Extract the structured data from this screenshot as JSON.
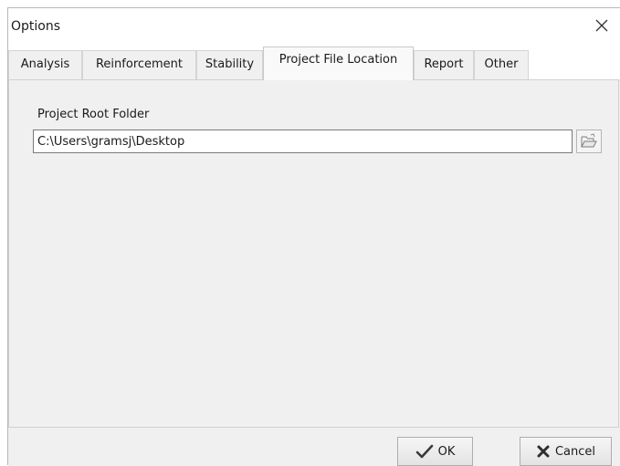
{
  "window": {
    "title": "Options"
  },
  "tabs": [
    {
      "label": "Analysis"
    },
    {
      "label": "Reinforcement"
    },
    {
      "label": "Stability"
    },
    {
      "label": "Project File Location"
    },
    {
      "label": "Report"
    },
    {
      "label": "Other"
    }
  ],
  "active_tab": "Project File Location",
  "project_file_location": {
    "root_folder_label": "Project Root Folder",
    "root_folder_value": "C:\\Users\\gramsj\\Desktop"
  },
  "footer": {
    "ok_label": "OK",
    "cancel_label": "Cancel"
  },
  "icons": {
    "close": "close-icon",
    "browse": "folder-open-icon",
    "ok": "checkmark-icon",
    "cancel": "x-mark-icon"
  },
  "colors": {
    "window_bg": "#f0f0f0",
    "titlebar_bg": "#ffffff",
    "input_border": "#7a7a7a"
  }
}
